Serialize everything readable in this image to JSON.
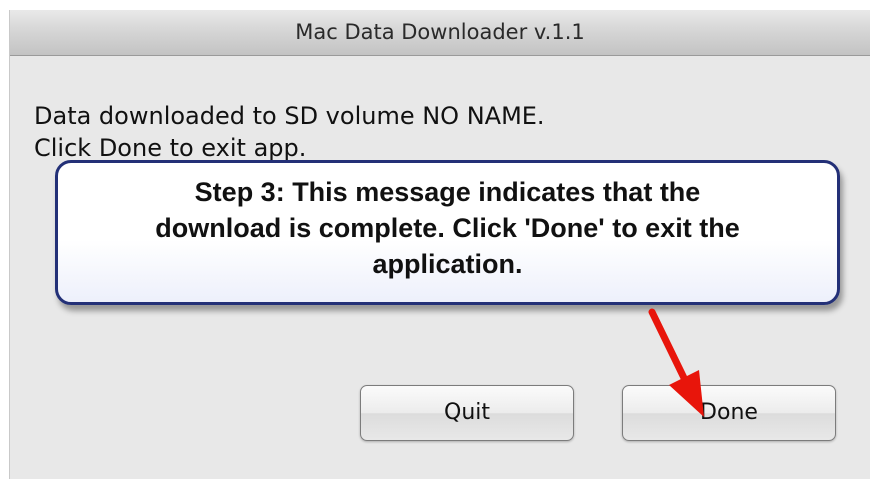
{
  "window": {
    "title": "Mac Data Downloader v.1.1"
  },
  "message": {
    "line1": "Data downloaded to SD volume NO NAME.",
    "line2": "Click Done to exit app."
  },
  "callout": {
    "lines": [
      "Step 3:  This message indicates that the",
      "download is complete. Click 'Done' to exit the",
      "application."
    ]
  },
  "buttons": {
    "quit": "Quit",
    "done": "Done"
  },
  "colors": {
    "callout_border": "#233077",
    "arrow": "#e8150b",
    "window_bg": "#e8e8e8"
  },
  "icons": {
    "arrow": "red-pointer-arrow-icon"
  }
}
